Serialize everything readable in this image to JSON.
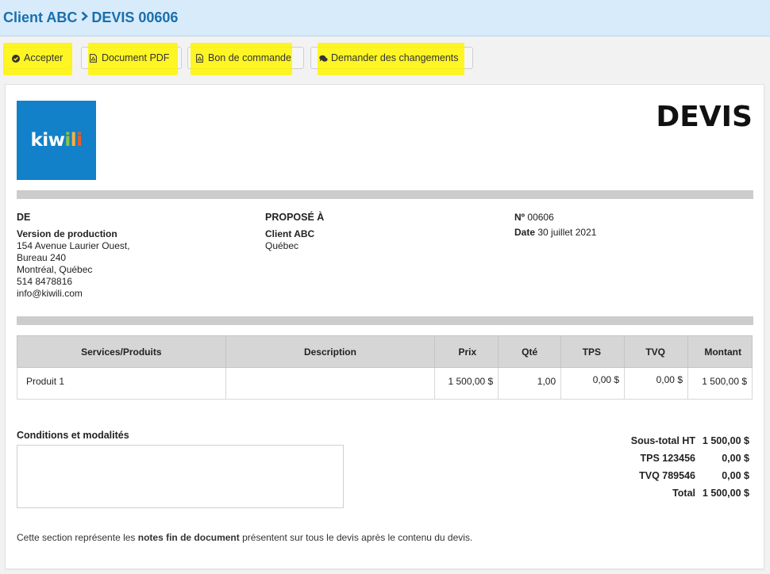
{
  "breadcrumb": {
    "client": "Client ABC",
    "document": "DEVIS 00606"
  },
  "toolbar": {
    "accept": "Accepter",
    "pdf": "Document PDF",
    "order": "Bon de commande",
    "changes": "Demander des changements"
  },
  "logo": {
    "k": "k",
    "i1": "i",
    "w": "w",
    "i2": "i",
    "l": "l",
    "i3": "i"
  },
  "title": "DEVIS",
  "from": {
    "heading": "DE",
    "name": "Version de production",
    "line1": "154 Avenue Laurier Ouest,",
    "line2": "Bureau 240",
    "line3": "Montréal, Québec",
    "phone": "514 8478816",
    "email": "info@kiwili.com"
  },
  "to": {
    "heading": "PROPOSÉ À",
    "name": "Client ABC",
    "region": "Québec"
  },
  "meta": {
    "no_label": "Nº",
    "no": "00606",
    "date_label": "Date",
    "date": "30 juillet 2021"
  },
  "table": {
    "headers": [
      "Services/Produits",
      "Description",
      "Prix",
      "Qté",
      "TPS",
      "TVQ",
      "Montant"
    ],
    "rows": [
      {
        "product": "Produit 1",
        "description": "",
        "price": "1 500,00 $",
        "qty": "1,00",
        "tps": "0,00 $",
        "tvq": "0,00 $",
        "amount": "1 500,00 $"
      }
    ]
  },
  "conditions_title": "Conditions et modalités",
  "totals": {
    "subtotal_label": "Sous-total HT",
    "subtotal": "1 500,00 $",
    "tps_label": "TPS 123456",
    "tps": "0,00 $",
    "tvq_label": "TVQ 789546",
    "tvq": "0,00 $",
    "total_label": "Total",
    "total": "1 500,00 $"
  },
  "notes": {
    "before": "Cette section représente les ",
    "bold": "notes fin de document",
    "after": " présentent sur tous le devis après le contenu du devis."
  },
  "colors": {
    "accent": "#1a6fab",
    "highlight": "#fff400",
    "logo_bg": "#1281c9"
  }
}
